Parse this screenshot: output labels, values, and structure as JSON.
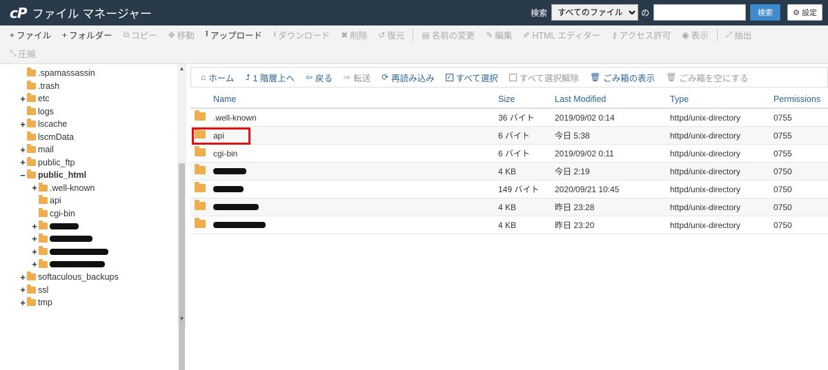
{
  "header": {
    "logo": "cP",
    "title": "ファイル マネージャー",
    "search_label": "検索",
    "search_scope": "すべてのファイル",
    "search_value": "",
    "search_button": "検索",
    "settings_button": "設定",
    "colors": {
      "header_bg": "#293a4a",
      "primary": "#428bca"
    }
  },
  "toolbar": {
    "row1": [
      {
        "icon": "plus-icon",
        "glyph": "+",
        "label": "ファイル",
        "disabled": false
      },
      {
        "icon": "plus-icon",
        "glyph": "+",
        "label": "フォルダー",
        "disabled": false
      },
      {
        "icon": "copy-icon",
        "glyph": "⧉",
        "label": "コピー",
        "disabled": true
      },
      {
        "icon": "move-icon",
        "glyph": "✥",
        "label": "移動",
        "disabled": true
      },
      {
        "icon": "upload-icon",
        "glyph": "⭱",
        "label": "アップロード",
        "disabled": false
      },
      {
        "icon": "download-icon",
        "glyph": "⭳",
        "label": "ダウンロード",
        "disabled": true
      },
      {
        "icon": "delete-icon",
        "glyph": "✖",
        "label": "削除",
        "disabled": true
      },
      {
        "icon": "restore-icon",
        "glyph": "↺",
        "label": "復元",
        "disabled": true
      },
      {
        "icon": "rename-icon",
        "glyph": "▤",
        "label": "名前の変更",
        "disabled": true
      },
      {
        "icon": "edit-icon",
        "glyph": "✎",
        "label": "編集",
        "disabled": true
      },
      {
        "icon": "html-editor-icon",
        "glyph": "✐",
        "label": "HTML エディター",
        "disabled": true
      },
      {
        "icon": "key-icon",
        "glyph": "⚷",
        "label": "アクセス許可",
        "disabled": true
      },
      {
        "icon": "eye-icon",
        "glyph": "◉",
        "label": "表示",
        "disabled": true
      },
      {
        "icon": "extract-icon",
        "glyph": "⤢",
        "label": "抽出",
        "disabled": true
      }
    ],
    "row2": [
      {
        "icon": "compress-icon",
        "glyph": "⤡",
        "label": "圧縮",
        "disabled": true
      }
    ]
  },
  "tree": [
    {
      "label": ".spamassassin",
      "toggle": "",
      "level": 1
    },
    {
      "label": ".trash",
      "toggle": "",
      "level": 1
    },
    {
      "label": "etc",
      "toggle": "+",
      "level": 1
    },
    {
      "label": "logs",
      "toggle": "",
      "level": 1
    },
    {
      "label": "lscache",
      "toggle": "+",
      "level": 1
    },
    {
      "label": "lscmData",
      "toggle": "",
      "level": 1
    },
    {
      "label": "mail",
      "toggle": "+",
      "level": 1
    },
    {
      "label": "public_ftp",
      "toggle": "+",
      "level": 1
    },
    {
      "label": "public_html",
      "toggle": "−",
      "level": 1,
      "bold": true
    },
    {
      "label": ".well-known",
      "toggle": "+",
      "level": 2
    },
    {
      "label": "api",
      "toggle": "",
      "level": 2
    },
    {
      "label": "cgi-bin",
      "toggle": "",
      "level": 2
    },
    {
      "label": "",
      "toggle": "+",
      "level": 2,
      "redacted": true
    },
    {
      "label": "",
      "toggle": "+",
      "level": 2,
      "redacted": true
    },
    {
      "label": "",
      "toggle": "+",
      "level": 2,
      "redacted": true
    },
    {
      "label": "",
      "toggle": "+",
      "level": 2,
      "redacted": true
    },
    {
      "label": "softaculous_backups",
      "toggle": "+",
      "level": 1
    },
    {
      "label": "ssl",
      "toggle": "+",
      "level": 1
    },
    {
      "label": "tmp",
      "toggle": "+",
      "level": 1
    }
  ],
  "navbar": [
    {
      "icon": "home-icon",
      "glyph": "⌂",
      "label": "ホーム",
      "disabled": false
    },
    {
      "icon": "level-up-icon",
      "glyph": "⮥",
      "label": "1 階層上へ",
      "disabled": false
    },
    {
      "icon": "arrow-left-icon",
      "glyph": "⇦",
      "label": "戻る",
      "disabled": false
    },
    {
      "icon": "arrow-right-icon",
      "glyph": "⇨",
      "label": "転送",
      "disabled": true
    },
    {
      "icon": "reload-icon",
      "glyph": "⟳",
      "label": "再読み込み",
      "disabled": false
    },
    {
      "icon": "checkbox-checked-icon",
      "glyph": "✓",
      "label": "すべて選択",
      "disabled": false,
      "checkbox": true
    },
    {
      "icon": "checkbox-empty-icon",
      "glyph": "",
      "label": "すべて選択解除",
      "disabled": true,
      "checkbox": true
    },
    {
      "icon": "trash-icon",
      "glyph": "🗑",
      "label": "ごみ箱の表示",
      "disabled": false
    },
    {
      "icon": "trash-icon",
      "glyph": "🗑",
      "label": "ごみ箱を空にする",
      "disabled": true
    }
  ],
  "table": {
    "headers": {
      "name": "Name",
      "size": "Size",
      "modified": "Last Modified",
      "type": "Type",
      "permissions": "Permissions"
    },
    "rows": [
      {
        "name": ".well-known",
        "size": "36 バイト",
        "modified": "2019/09/02 0:14",
        "type": "httpd/unix-directory",
        "perm": "0755"
      },
      {
        "name": "api",
        "size": "6 バイト",
        "modified": "今日 5:38",
        "type": "httpd/unix-directory",
        "perm": "0755",
        "highlighted": true
      },
      {
        "name": "cgi-bin",
        "size": "6 バイト",
        "modified": "2019/09/02 0:11",
        "type": "httpd/unix-directory",
        "perm": "0755"
      },
      {
        "name": "",
        "size": "4 KB",
        "modified": "今日 2:19",
        "type": "httpd/unix-directory",
        "perm": "0750",
        "redacted": true
      },
      {
        "name": "",
        "size": "149 バイト",
        "modified": "2020/09/21 10:45",
        "type": "httpd/unix-directory",
        "perm": "0750",
        "redacted": true
      },
      {
        "name": "",
        "size": "4 KB",
        "modified": "昨日 23:28",
        "type": "httpd/unix-directory",
        "perm": "0750",
        "redacted": true
      },
      {
        "name": "",
        "size": "4 KB",
        "modified": "昨日 23:20",
        "type": "httpd/unix-directory",
        "perm": "0750",
        "redacted": true
      }
    ]
  }
}
